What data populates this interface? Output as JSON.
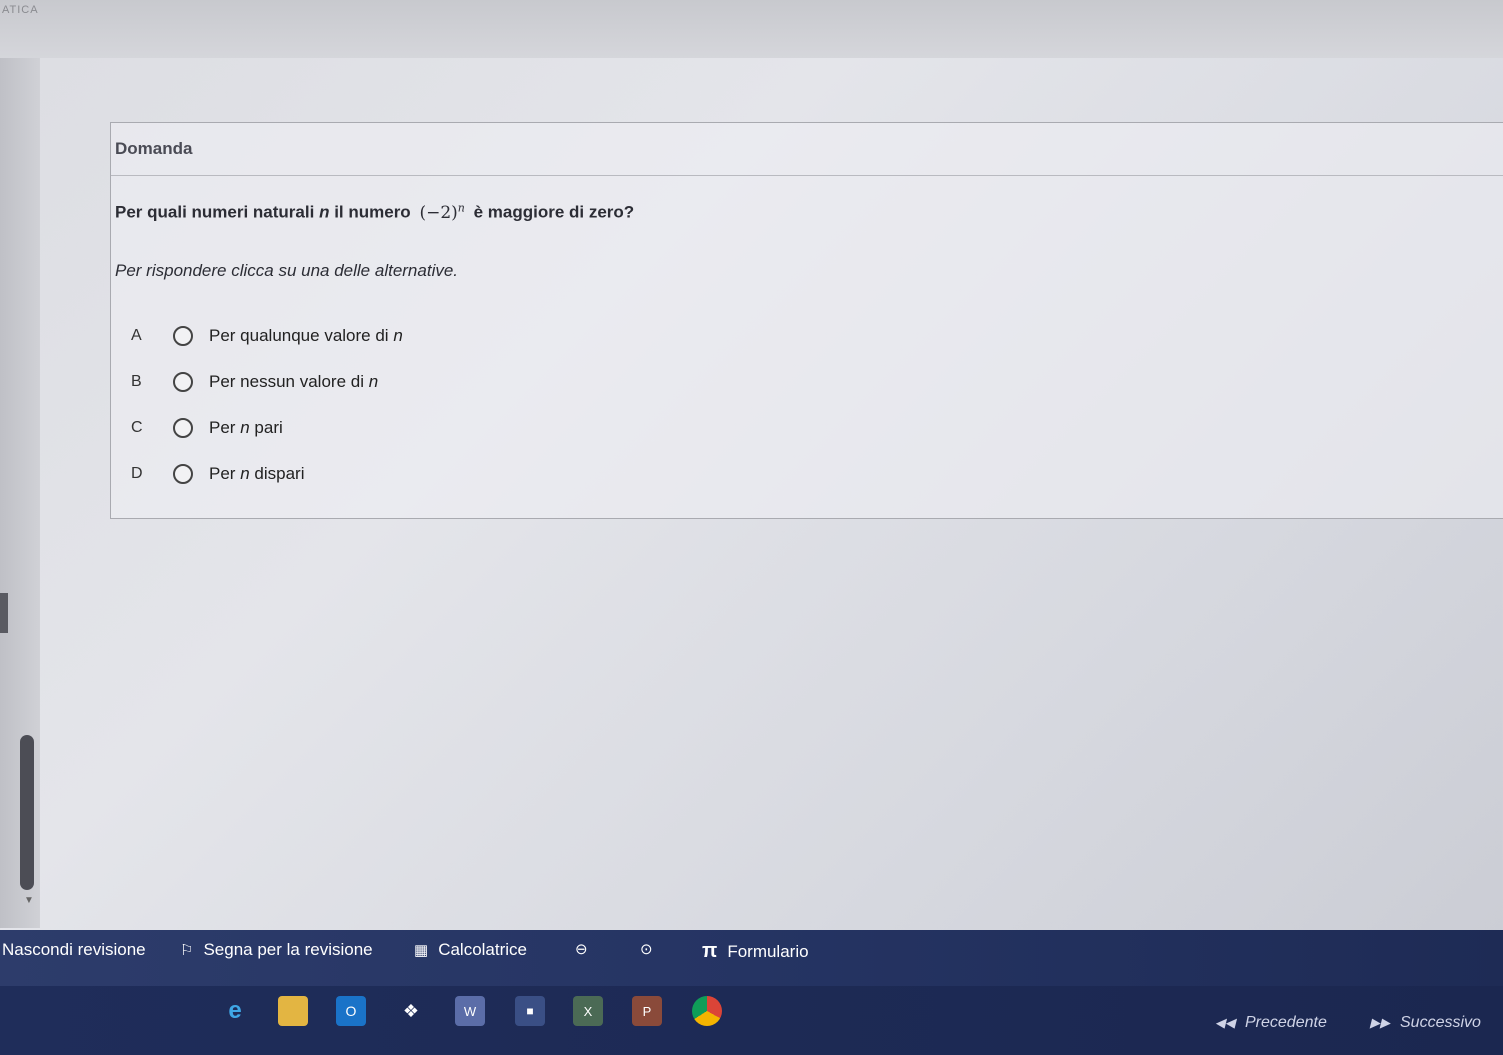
{
  "app": {
    "title_fragment": "ATICA"
  },
  "card": {
    "header": "Domanda",
    "question_before": "Per quali numeri naturali",
    "question_var": "n",
    "question_mid": "il numero",
    "question_math_base": "(−2)",
    "question_math_exp": "n",
    "question_after": "è maggiore di zero?",
    "instruction": "Per rispondere clicca su una delle alternative."
  },
  "options": [
    {
      "letter": "A",
      "pre": "Per qualunque valore di",
      "var": "n",
      "post": ""
    },
    {
      "letter": "B",
      "pre": "Per nessun valore di",
      "var": "n",
      "post": ""
    },
    {
      "letter": "C",
      "pre": "Per",
      "var": "n",
      "post": "pari"
    },
    {
      "letter": "D",
      "pre": "Per",
      "var": "n",
      "post": "dispari"
    }
  ],
  "toolbar": {
    "hide_review": "Nascondi revisione",
    "mark_review": "Segna per la revisione",
    "calculator": "Calcolatrice",
    "formulary": "Formulario"
  },
  "navigation": {
    "previous": "Precedente",
    "next": "Successivo"
  },
  "taskbar_icons": [
    "edge-icon",
    "file-explorer-icon",
    "outlook-icon",
    "dropbox-icon",
    "word-icon",
    "store-icon",
    "excel-icon",
    "powerpoint-icon",
    "chrome-icon"
  ],
  "colors": {
    "bottom_bar": "#253463",
    "card_border": "#a9aab0"
  }
}
